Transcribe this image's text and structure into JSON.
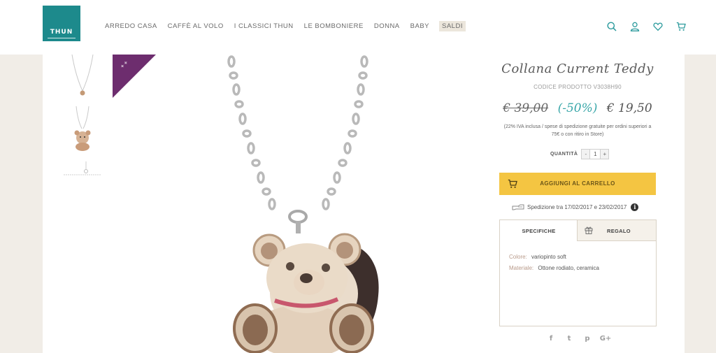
{
  "header": {
    "logo_text": "THUN",
    "nav": [
      "ARREDO CASA",
      "CAFFÈ AL VOLO",
      "I CLASSICI THUN",
      "LE BOMBONIERE",
      "DONNA",
      "BABY",
      "SALDI"
    ],
    "icons": [
      "search-icon",
      "user-icon",
      "heart-icon",
      "cart-icon"
    ]
  },
  "gallery": {
    "thumbnails": [
      "necklace-full-view",
      "teddy-pendant-closeup",
      "necklace-clasp"
    ],
    "main_image": "teddy-bear-necklace",
    "badge_icon": "sale-tag-icon"
  },
  "product": {
    "title": "Collana Current Teddy",
    "code": "CODICE PRODOTTO V3038H90",
    "price_old": "€ 39,00",
    "discount": "(-50%)",
    "price_new": "€ 19,50",
    "vat_note": "(22% IVA inclusa / spese di spedizione gratuite per ordini superiori a 75€ o con ritiro in Store)",
    "qty_label": "QUANTITÀ",
    "qty_minus": "-",
    "qty_value": "1",
    "qty_plus": "+",
    "add_to_cart": "AGGIUNGI AL CARRELLO",
    "shipping": "Spedizione tra 17/02/2017 e 23/02/2017",
    "info_glyph": "i"
  },
  "tabs": {
    "spec_label": "SPECIFICHE",
    "gift_label": "REGALO",
    "specs": [
      {
        "key": "Colore:",
        "value": "variopinto soft"
      },
      {
        "key": "Materiale:",
        "value": "Ottone rodiato, ceramica"
      }
    ]
  },
  "social": [
    "f",
    "t",
    "p",
    "G+"
  ],
  "colors": {
    "brand_teal": "#1d8a8c",
    "accent_teal": "#3aa7a9",
    "cart_yellow": "#f4c542",
    "badge_purple": "#6d2d6e",
    "background_beige": "#f1ede7"
  }
}
